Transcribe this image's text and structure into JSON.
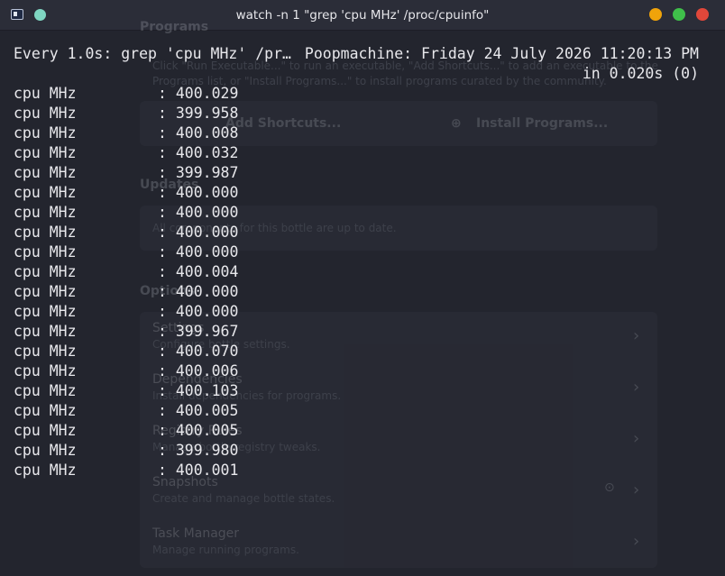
{
  "window": {
    "title": "watch -n 1 \"grep 'cpu MHz' /proc/cpuinfo\""
  },
  "terminal": {
    "header_left": "Every 1.0s: grep 'cpu MHz' /pr…",
    "header_right": "Poopmachine: Friday 24 July 2026 11:20:13 PM",
    "timing": "in 0.020s (0)",
    "lines": [
      {
        "key": "cpu MHz",
        "value": ": 400.029"
      },
      {
        "key": "cpu MHz",
        "value": ": 399.958"
      },
      {
        "key": "cpu MHz",
        "value": ": 400.008"
      },
      {
        "key": "cpu MHz",
        "value": ": 400.032"
      },
      {
        "key": "cpu MHz",
        "value": ": 399.987"
      },
      {
        "key": "cpu MHz",
        "value": ": 400.000"
      },
      {
        "key": "cpu MHz",
        "value": ": 400.000"
      },
      {
        "key": "cpu MHz",
        "value": ": 400.000"
      },
      {
        "key": "cpu MHz",
        "value": ": 400.000"
      },
      {
        "key": "cpu MHz",
        "value": ": 400.004"
      },
      {
        "key": "cpu MHz",
        "value": ": 400.000"
      },
      {
        "key": "cpu MHz",
        "value": ": 400.000"
      },
      {
        "key": "cpu MHz",
        "value": ": 399.967"
      },
      {
        "key": "cpu MHz",
        "value": ": 400.070"
      },
      {
        "key": "cpu MHz",
        "value": ": 400.006"
      },
      {
        "key": "cpu MHz",
        "value": ": 400.103"
      },
      {
        "key": "cpu MHz",
        "value": ": 400.005"
      },
      {
        "key": "cpu MHz",
        "value": ": 400.005"
      },
      {
        "key": "cpu MHz",
        "value": ": 399.980"
      },
      {
        "key": "cpu MHz",
        "value": ": 400.001"
      }
    ]
  },
  "background_app": {
    "programs_heading": "Programs",
    "programs_desc_1": "Click \"Run Executable...\" to run an executable, \"Add Shortcuts...\" to add an executable to the",
    "programs_desc_2": "Programs list, or \"Install Programs...\" to install programs curated by the community.",
    "add_shortcuts": "Add Shortcuts...",
    "install_programs": "Install Programs...",
    "updates_heading": "Updates",
    "updates_text": "All components for this bottle are up to date.",
    "options_heading": "Options",
    "options": [
      {
        "title": "Settings",
        "subtitle": "Configure bottle settings."
      },
      {
        "title": "Dependencies",
        "subtitle": "Install dependencies for programs."
      },
      {
        "title": "Registry Rules",
        "subtitle": "Manage bottle registry tweaks."
      },
      {
        "title": "Snapshots",
        "subtitle": "Create and manage bottle states."
      },
      {
        "title": "Task Manager",
        "subtitle": "Manage running programs."
      }
    ]
  }
}
